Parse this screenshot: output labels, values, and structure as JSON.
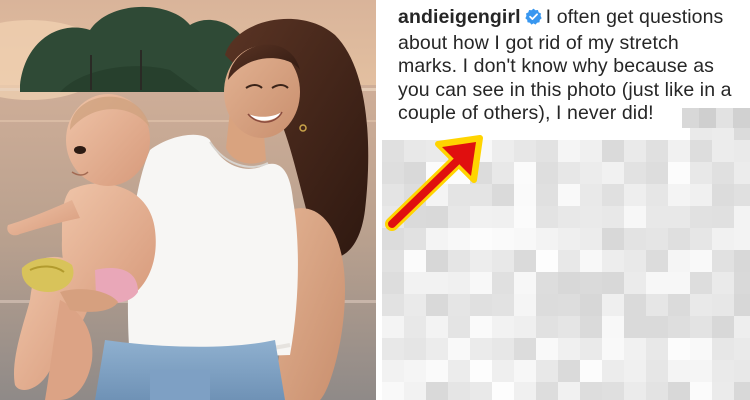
{
  "post": {
    "username": "andieigengirl",
    "caption_text": "I often get questions about how I got rid of my stretch marks. I don't know why because as you can see in this photo (just like in a couple of others), I never did!",
    "verified": true
  },
  "colors": {
    "arrow_fill": "#e00f0f",
    "arrow_outline": "#ffd400",
    "verified_badge": "#3897f0",
    "text": "#262626"
  },
  "icons": {
    "verified": "verified-badge-icon",
    "arrow": "red-arrow-icon"
  }
}
